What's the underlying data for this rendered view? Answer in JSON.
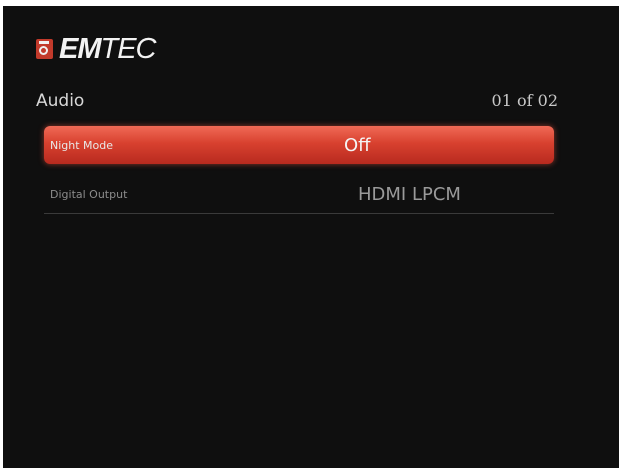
{
  "brand": {
    "name_strong": "EM",
    "name_light": "TEC"
  },
  "header": {
    "section_title": "Audio",
    "page_indicator": "01 of 02"
  },
  "menu": {
    "items": [
      {
        "label": "Night Mode",
        "value": "Off",
        "selected": true
      },
      {
        "label": "Digital Output",
        "value": "HDMI LPCM",
        "selected": false
      }
    ]
  },
  "colors": {
    "background": "#0f0f0f",
    "highlight": "#d8412f",
    "logo_accent": "#c23a2b"
  }
}
